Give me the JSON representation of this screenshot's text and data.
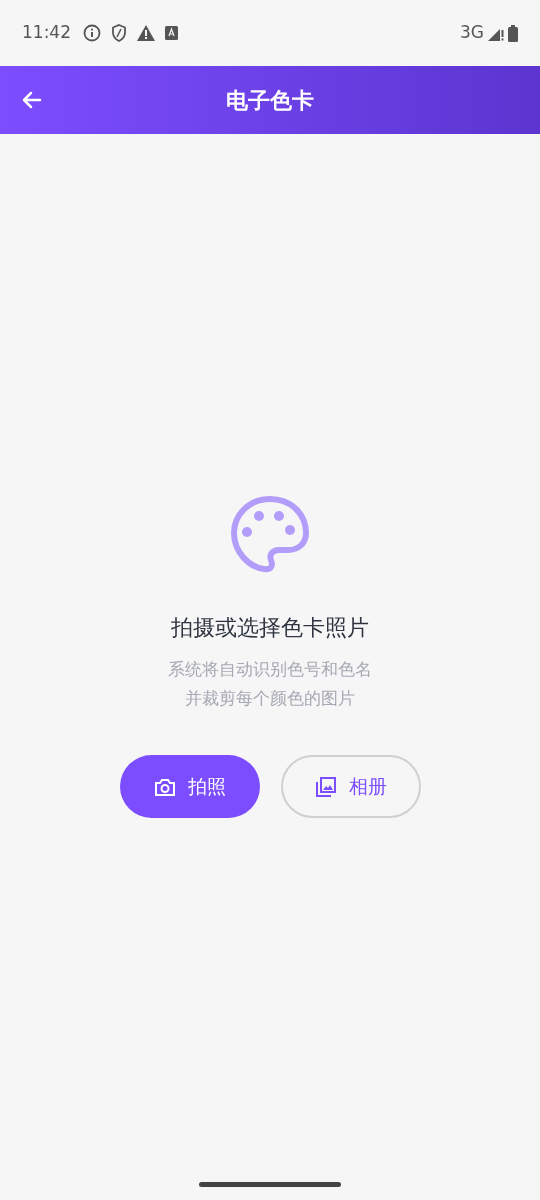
{
  "status_bar": {
    "time": "11:42",
    "network": "3G"
  },
  "header": {
    "title": "电子色卡"
  },
  "empty_state": {
    "title": "拍摄或选择色卡照片",
    "description_lines": [
      "系统将自动识别色号和色名",
      "并裁剪每个颜色的图片"
    ]
  },
  "buttons": [
    {
      "kind": "primary",
      "label": "拍照"
    },
    {
      "kind": "outline",
      "label": "相册"
    }
  ]
}
